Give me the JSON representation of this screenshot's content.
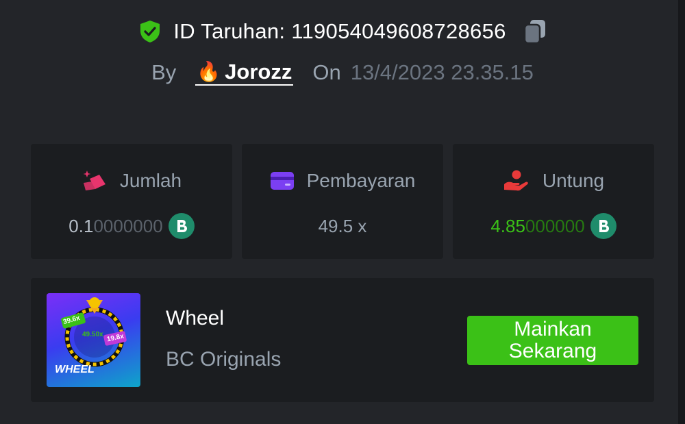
{
  "header": {
    "bet_id": "ID Taruhan: 119054049608728656",
    "by_label": "By",
    "username": "Jorozz",
    "on_label": "On",
    "date": "13/4/2023 23.35.15"
  },
  "stats": {
    "amount": {
      "label": "Jumlah",
      "value_main": "0.1",
      "value_dim": "0000000"
    },
    "payout": {
      "label": "Pembayaran",
      "value": "49.5 x"
    },
    "profit": {
      "label": "Untung",
      "value_main": "4.85",
      "value_dim": "000000"
    }
  },
  "game": {
    "thumb_label": "WHEEL",
    "thumb_values": [
      "39.6x",
      "49.50x",
      "19.8x"
    ],
    "title": "Wheel",
    "provider": "BC Originals",
    "play_label_line1": "Mainkan",
    "play_label_line2": "Sekarang"
  },
  "icons": {
    "verified": "shield-check-icon",
    "copy": "copy-icon",
    "user_flair": "fire-icon",
    "amount": "bet-amount-icon",
    "payout": "card-icon",
    "profit": "hand-profit-icon",
    "coin": "bc-coin-icon"
  },
  "colors": {
    "accent_green": "#3bc117",
    "coin": "#1f8c6b",
    "amount_icon": "#e8356d",
    "payout_icon": "#7b3ff2",
    "profit_icon": "#e83a3a"
  }
}
